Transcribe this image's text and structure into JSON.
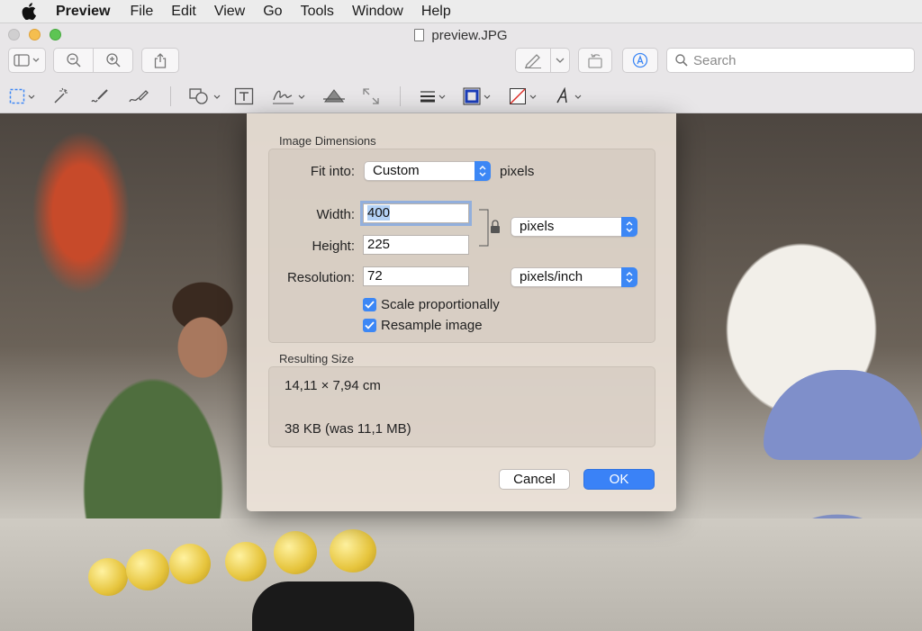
{
  "menubar": {
    "app": "Preview",
    "items": [
      "File",
      "Edit",
      "View",
      "Go",
      "Tools",
      "Window",
      "Help"
    ]
  },
  "window": {
    "title": "preview.JPG"
  },
  "toolbar": {
    "search_placeholder": "Search"
  },
  "dialog": {
    "image_dimensions_label": "Image Dimensions",
    "fit_into_label": "Fit into:",
    "fit_into_value": "Custom",
    "fit_into_unit": "pixels",
    "width_label": "Width:",
    "width_value": "400",
    "height_label": "Height:",
    "height_value": "225",
    "size_unit": "pixels",
    "resolution_label": "Resolution:",
    "resolution_value": "72",
    "resolution_unit": "pixels/inch",
    "scale_proportionally": "Scale proportionally",
    "scale_proportionally_checked": true,
    "resample_image": "Resample image",
    "resample_image_checked": true,
    "resulting_size_label": "Resulting Size",
    "resulting_dimensions": "14,11 × 7,94 cm",
    "resulting_filesize": "38 KB (was 11,1 MB)",
    "cancel_label": "Cancel",
    "ok_label": "OK"
  },
  "colors": {
    "accent": "#3a82f7",
    "menubar_bg": "#ececec",
    "window_chrome": "#e8e6e8"
  }
}
